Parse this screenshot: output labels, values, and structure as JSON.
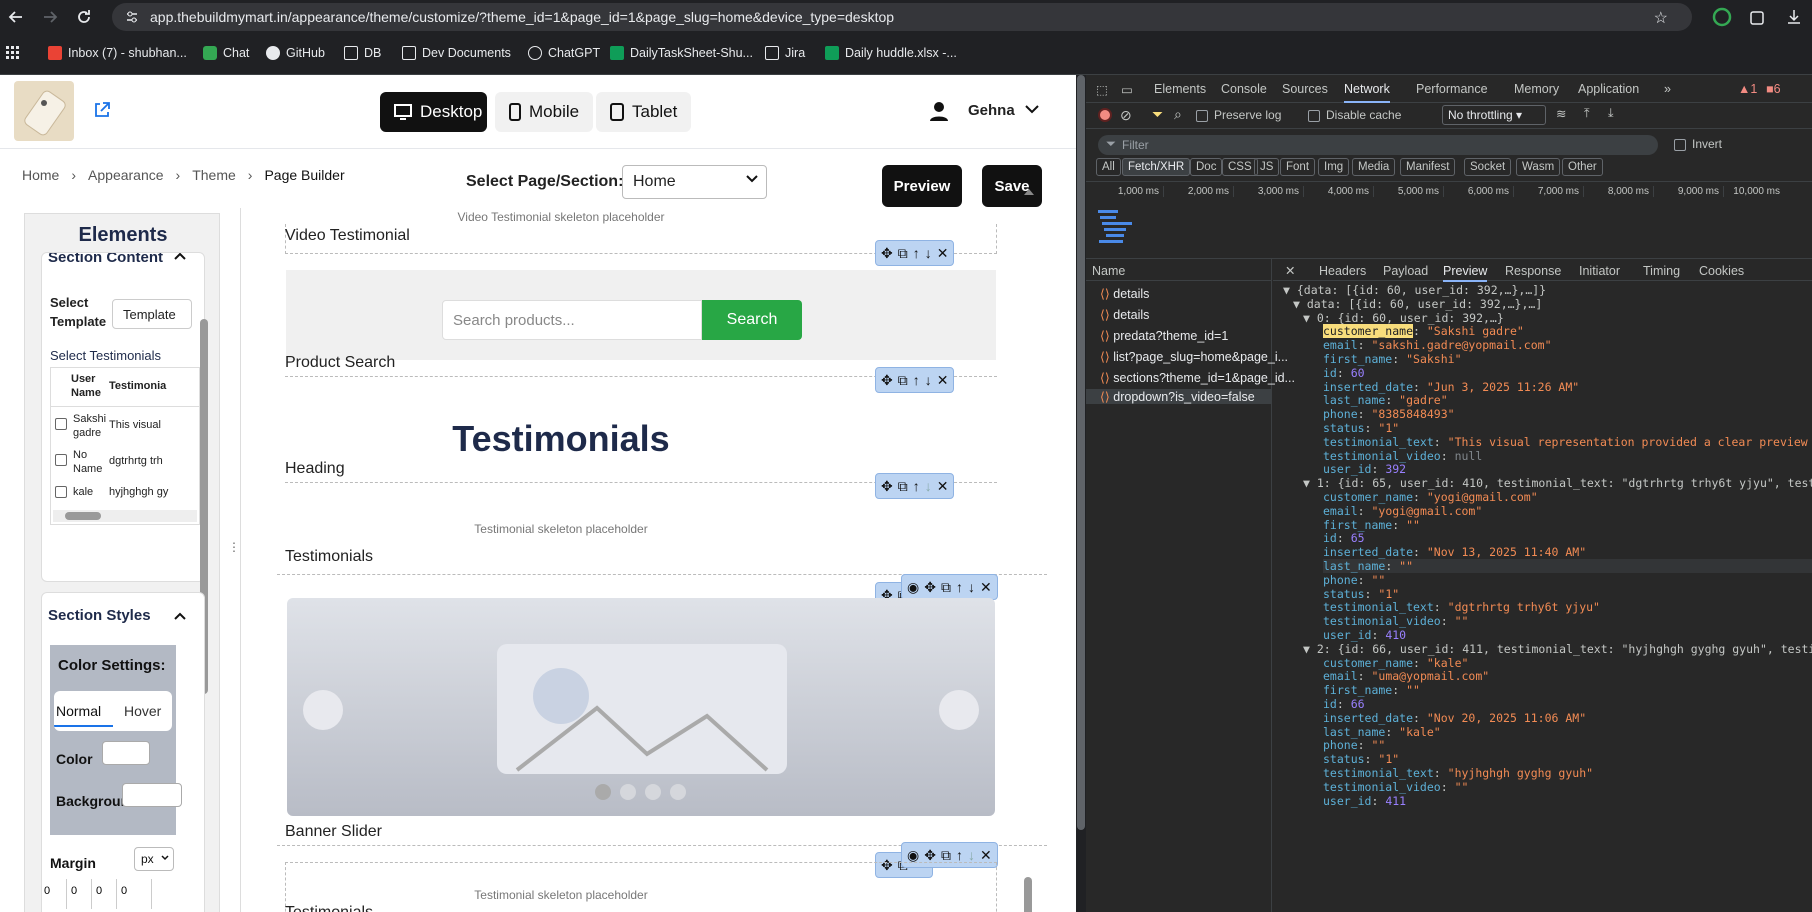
{
  "browser": {
    "url": "app.thebuildmymart.in/appearance/theme/customize/?theme_id=1&page_id=1&page_slug=home&device_type=desktop",
    "bookmarks": [
      "Inbox (7) - shubhan...",
      "Chat",
      "GitHub",
      "DB",
      "Dev Documents",
      "ChatGPT",
      "DailyTaskSheet-Shu...",
      "Jira",
      "Daily huddle.xlsx -..."
    ]
  },
  "header": {
    "devices": [
      "Desktop",
      "Mobile",
      "Tablet"
    ],
    "user": "Gehna"
  },
  "breadcrumb": [
    "Home",
    "Appearance",
    "Theme",
    "Page Builder"
  ],
  "page_select": {
    "label": "Select Page/Section:",
    "value": "Home"
  },
  "actions": {
    "preview": "Preview",
    "save": "Save"
  },
  "sidebar": {
    "title": "Elements",
    "section_content": "Section Content",
    "select_template": "Select Template",
    "template_value": "Template",
    "select_testimonials": "Select Testimonials",
    "table_headers": [
      "User Name",
      "Testimonia"
    ],
    "rows": [
      {
        "name": "Sakshi gadre",
        "text": "This visual"
      },
      {
        "name": "No Name",
        "text": "dgtrhrtg trh"
      },
      {
        "name": "kale",
        "text": "hyjhghgh gy"
      }
    ],
    "section_styles": "Section Styles",
    "color_settings": "Color Settings:",
    "tabs": [
      "Normal",
      "Hover"
    ],
    "color": "Color",
    "background": "Background",
    "margin": "Margin",
    "margin_unit": "px",
    "margin_values": [
      "0",
      "0",
      "0",
      "0"
    ]
  },
  "canvas": {
    "video_skel": "Video Testimonial skeleton placeholder",
    "video_label": "Video Testimonial",
    "search_placeholder": "Search products...",
    "search_btn": "Search",
    "product_search": "Product Search",
    "heading_text": "Testimonials",
    "heading_label": "Heading",
    "testi_skel": "Testimonial skeleton placeholder",
    "testi_label": "Testimonials",
    "banner_label": "Banner Slider",
    "testi_skel2": "Testimonial skeleton placeholder",
    "testi_label2": "Testimonials"
  },
  "devtools": {
    "tabs": [
      "Elements",
      "Console",
      "Sources",
      "Network",
      "Performance",
      "Memory",
      "Application"
    ],
    "errors": "1",
    "warnings": "6",
    "preserve_log": "Preserve log",
    "disable_cache": "Disable cache",
    "throttle": "No throttling",
    "filter": "Filter",
    "invert": "Invert",
    "chips": [
      "All",
      "Fetch/XHR",
      "Doc",
      "CSS",
      "JS",
      "Font",
      "Img",
      "Media",
      "Manifest",
      "Socket",
      "Wasm",
      "Other"
    ],
    "timeline": [
      "1,000 ms",
      "2,000 ms",
      "3,000 ms",
      "4,000 ms",
      "5,000 ms",
      "6,000 ms",
      "7,000 ms",
      "8,000 ms",
      "9,000 ms",
      "10,000 ms"
    ],
    "name_header": "Name",
    "requests": [
      "details",
      "details",
      "predata?theme_id=1",
      "list?page_slug=home&page_i...",
      "sections?theme_id=1&page_id...",
      "dropdown?is_video=false"
    ],
    "detail_tabs": [
      "Headers",
      "Payload",
      "Preview",
      "Response",
      "Initiator",
      "Timing",
      "Cookies"
    ],
    "json_lines": [
      {
        "t": "▼ {data: [{id: 60, user_id: 392,…},…]}",
        "c": "k"
      },
      {
        "t": "▼ data: [{id: 60, user_id: 392,…},…]",
        "c": "k"
      },
      {
        "t": "▼ 0: {id: 60, user_id: 392,…}",
        "c": "k"
      },
      {
        "k": "customer_name",
        "v": "\"Sakshi gadre\"",
        "vc": "s"
      },
      {
        "k": "email",
        "v": "\"sakshi.gadre@yopmail.com\"",
        "vc": "s"
      },
      {
        "k": "first_name",
        "v": "\"Sakshi\"",
        "vc": "s"
      },
      {
        "k": "id",
        "v": "60",
        "vc": "n"
      },
      {
        "k": "inserted_date",
        "v": "\"Jun 3, 2025 11:26 AM\"",
        "vc": "s"
      },
      {
        "k": "last_name",
        "v": "\"gadre\"",
        "vc": "s"
      },
      {
        "k": "phone",
        "v": "\"8385848493\"",
        "vc": "s"
      },
      {
        "k": "status",
        "v": "\"1\"",
        "vc": "s"
      },
      {
        "k": "testimonial_text",
        "v": "\"This visual representation provided a clear preview",
        "vc": "s"
      },
      {
        "k": "testimonial_video",
        "v": "null",
        "vc": "nu"
      },
      {
        "k": "user_id",
        "v": "392",
        "vc": "n"
      },
      {
        "t": "▼ 1: {id: 65, user_id: 410, testimonial_text: \"dgtrhrtg trhy6t yjyu\", test",
        "c": "k"
      },
      {
        "k": "customer_name",
        "v": "\"yogi@gmail.com\"",
        "vc": "s"
      },
      {
        "k": "email",
        "v": "\"yogi@gmail.com\"",
        "vc": "s"
      },
      {
        "k": "first_name",
        "v": "\"\"",
        "vc": "s"
      },
      {
        "k": "id",
        "v": "65",
        "vc": "n"
      },
      {
        "k": "inserted_date",
        "v": "\"Nov 13, 2025 11:40 AM\"",
        "vc": "s"
      },
      {
        "k": "last_name",
        "v": "\"\"",
        "vc": "s"
      },
      {
        "k": "phone",
        "v": "\"\"",
        "vc": "s"
      },
      {
        "k": "status",
        "v": "\"1\"",
        "vc": "s"
      },
      {
        "k": "testimonial_text",
        "v": "\"dgtrhrtg trhy6t yjyu\"",
        "vc": "s"
      },
      {
        "k": "testimonial_video",
        "v": "\"\"",
        "vc": "s"
      },
      {
        "k": "user_id",
        "v": "410",
        "vc": "n"
      },
      {
        "t": "▼ 2: {id: 66, user_id: 411, testimonial_text: \"hyjhghgh gyghg gyuh\", testi",
        "c": "k"
      },
      {
        "k": "customer_name",
        "v": "\"kale\"",
        "vc": "s"
      },
      {
        "k": "email",
        "v": "\"uma@yopmail.com\"",
        "vc": "s"
      },
      {
        "k": "first_name",
        "v": "\"\"",
        "vc": "s"
      },
      {
        "k": "id",
        "v": "66",
        "vc": "n"
      },
      {
        "k": "inserted_date",
        "v": "\"Nov 20, 2025 11:06 AM\"",
        "vc": "s"
      },
      {
        "k": "last_name",
        "v": "\"kale\"",
        "vc": "s"
      },
      {
        "k": "phone",
        "v": "\"\"",
        "vc": "s"
      },
      {
        "k": "status",
        "v": "\"1\"",
        "vc": "s"
      },
      {
        "k": "testimonial_text",
        "v": "\"hyjhghgh gyghg gyuh\"",
        "vc": "s"
      },
      {
        "k": "testimonial_video",
        "v": "\"\"",
        "vc": "s"
      },
      {
        "k": "user_id",
        "v": "411",
        "vc": "n"
      }
    ]
  }
}
